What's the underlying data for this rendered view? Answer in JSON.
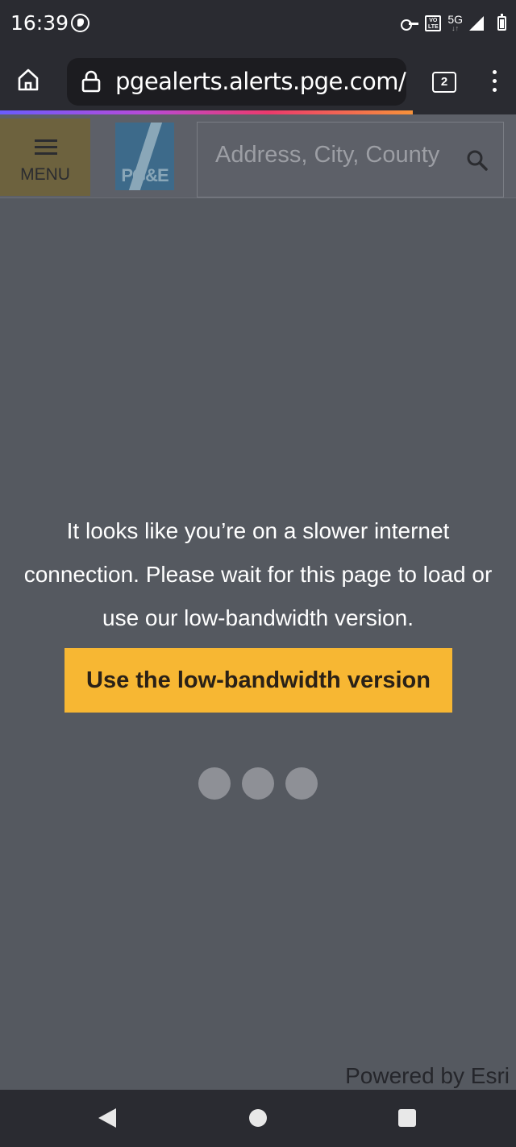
{
  "status_bar": {
    "time": "16:39",
    "network": "5G",
    "volte_label": "VO LTE",
    "icons": [
      "location-icon",
      "vpn-key-icon",
      "volte-icon",
      "signal-icon",
      "battery-icon"
    ]
  },
  "browser": {
    "url": "pgealerts.alerts.pge.com/outages",
    "tab_count": "2",
    "icons": [
      "home-icon",
      "lock-icon",
      "tabs-icon",
      "overflow-menu-icon"
    ],
    "progress_fraction": 0.8
  },
  "header": {
    "menu_label": "MENU",
    "logo_text": "PG&E",
    "search_placeholder": "Address, City, County"
  },
  "main": {
    "message": "It looks like you’re on a slower internet connection. Please wait for this page to load or use our low-bandwidth version.",
    "cta_label": "Use the low-bandwidth version",
    "loading_dots": 3,
    "footer_attribution": "Powered by Esri"
  },
  "nav": {
    "icons": [
      "back-icon",
      "home-icon",
      "recents-icon"
    ]
  },
  "colors": {
    "page_bg": "#555960",
    "cta_bg": "#f7b733",
    "menu_bg": "#6d623e",
    "chrome_bg": "#2a2b31"
  }
}
